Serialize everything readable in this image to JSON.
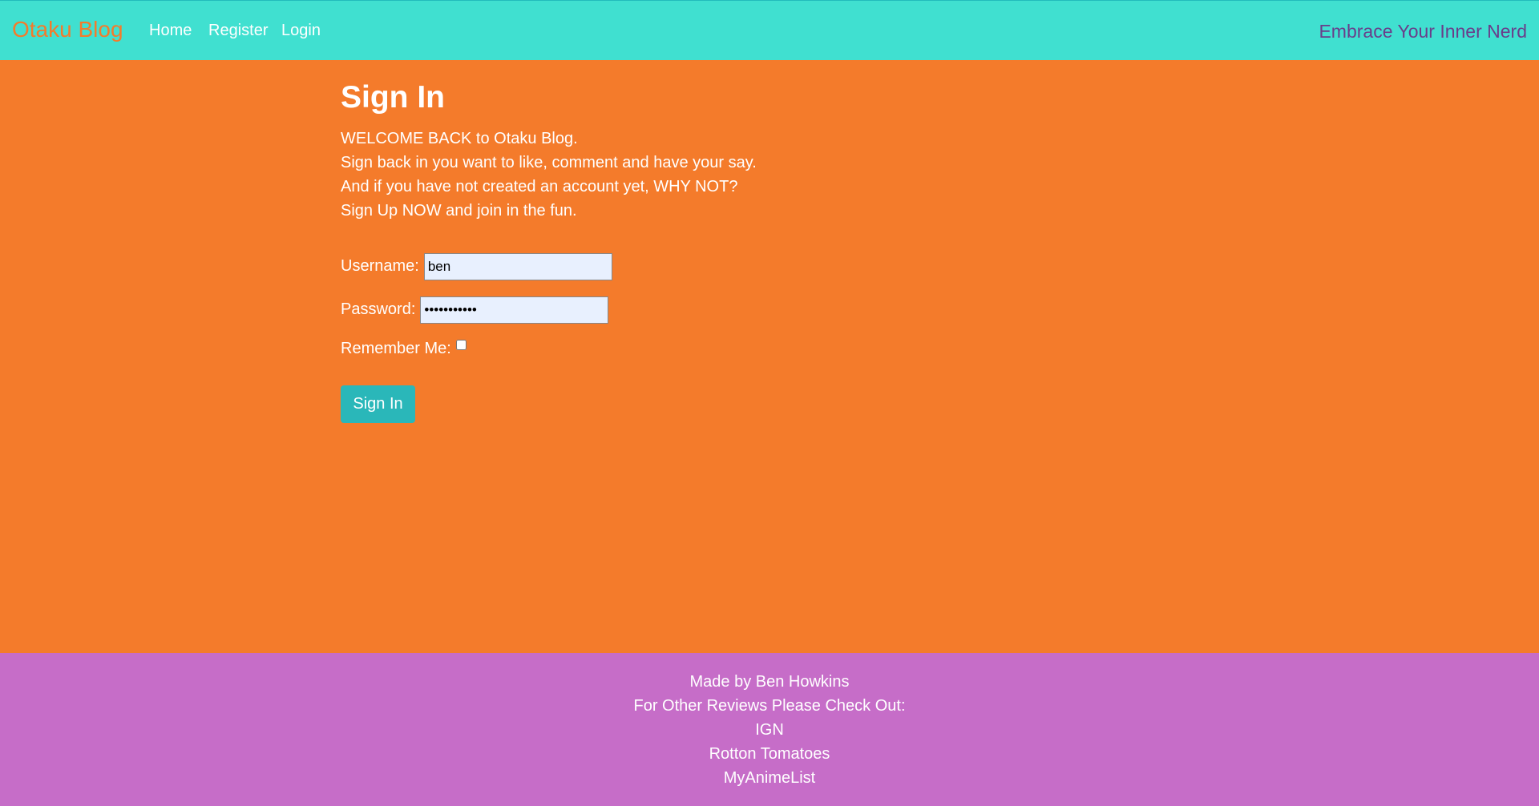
{
  "navbar": {
    "brand": "Otaku Blog",
    "links": [
      "Home",
      "Register",
      "Login"
    ],
    "tagline": "Embrace Your Inner Nerd"
  },
  "main": {
    "title": "Sign In",
    "intro": [
      "WELCOME BACK to Otaku Blog.",
      "Sign back in you want to like, comment and have your say.",
      "And if you have not created an account yet, WHY NOT?",
      "Sign Up NOW and join in the fun."
    ],
    "form": {
      "username_label": "Username:",
      "username_value": "ben",
      "password_label": "Password:",
      "password_value": "•••••••••••",
      "remember_label": "Remember Me:",
      "submit_label": "Sign In"
    }
  },
  "footer": {
    "made_by": "Made by Ben Howkins",
    "other_reviews": "For Other Reviews Please Check Out:",
    "links": [
      "IGN",
      "Rotton Tomatoes",
      "MyAnimeList"
    ]
  },
  "colors": {
    "navbar_bg": "#40e0d0",
    "page_bg": "#f47b2b",
    "footer_bg": "#c66dc8",
    "button_bg": "#2ab7b9",
    "tagline": "#6a3d8a"
  }
}
